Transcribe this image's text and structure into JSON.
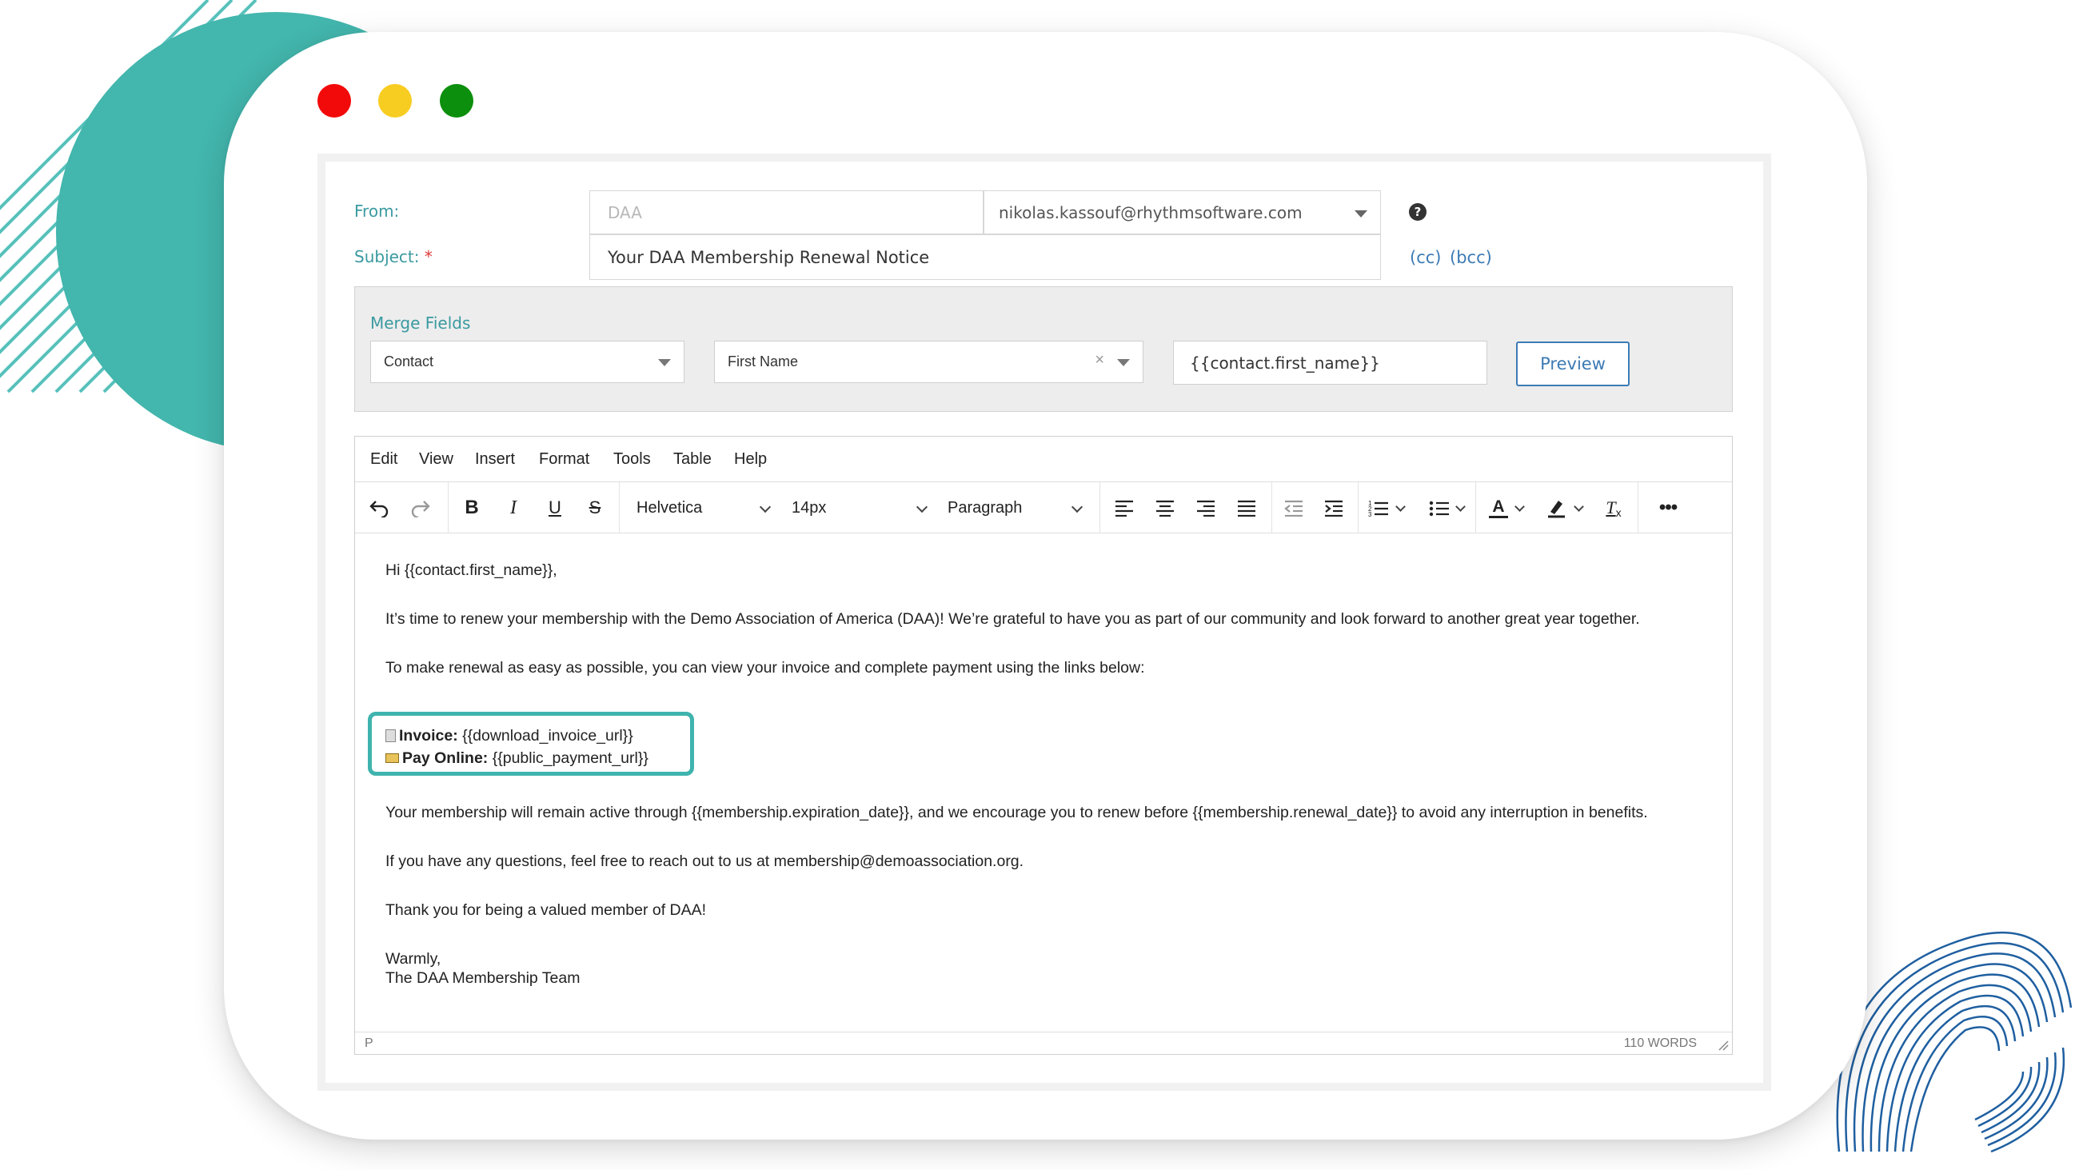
{
  "from": {
    "label": "From:",
    "name_placeholder": "DAA",
    "email": "nikolas.kassouf@rhythmsoftware.com"
  },
  "subject": {
    "label": "Subject:",
    "required_marker": "*",
    "value": "Your DAA Membership Renewal Notice"
  },
  "help_icon": "question-circle-icon",
  "cc_label": "(cc)",
  "bcc_label": "(bcc)",
  "merge": {
    "title": "Merge Fields",
    "entity": "Contact",
    "field": "First Name",
    "clear_glyph": "×",
    "token": "{{contact.first_name}}",
    "preview_label": "Preview"
  },
  "editor": {
    "menu": [
      "Edit",
      "View",
      "Insert",
      "Format",
      "Tools",
      "Table",
      "Help"
    ],
    "font_family": "Helvetica",
    "font_size": "14px",
    "block_format": "Paragraph",
    "toolbar_icons": [
      "undo-icon",
      "redo-icon",
      "bold-icon",
      "italic-icon",
      "underline-icon",
      "strikethrough-icon",
      "align-left-icon",
      "align-center-icon",
      "align-right-icon",
      "align-justify-icon",
      "outdent-icon",
      "indent-icon",
      "numbered-list-icon",
      "bullet-list-icon",
      "text-color-icon",
      "highlight-icon",
      "clear-formatting-icon",
      "more-icon"
    ],
    "body": {
      "greeting": "Hi {{contact.first_name}},",
      "p1": "It’s time to renew your membership with the Demo Association of America (DAA)! We’re grateful to have you as part of our community and look forward to another great year together.",
      "p2": "To make renewal as easy as possible, you can view your invoice and complete payment using the links below:",
      "invoice_label": "Invoice:",
      "invoice_value": "{{download_invoice_url}}",
      "pay_label": "Pay Online:",
      "pay_value": "{{public_payment_url}}",
      "p3": "Your membership will remain active through {{membership.expiration_date}}, and we encourage you to renew before {{membership.renewal_date}} to avoid any interruption in benefits.",
      "p4": "If you have any questions, feel free to reach out to us at membership@demoassociation.org.",
      "p5": "Thank you for being a valued member of DAA!",
      "closing": "Warmly,",
      "signature": "The DAA Membership Team"
    },
    "status_path": "P",
    "word_count": "110 WORDS"
  },
  "colors": {
    "teal_accent": "#3fb3ae",
    "label_teal": "#3a9aa0",
    "link_blue": "#3c7bb5",
    "required_red": "#e03a3a",
    "navy_lines": "#1f5fa0"
  }
}
